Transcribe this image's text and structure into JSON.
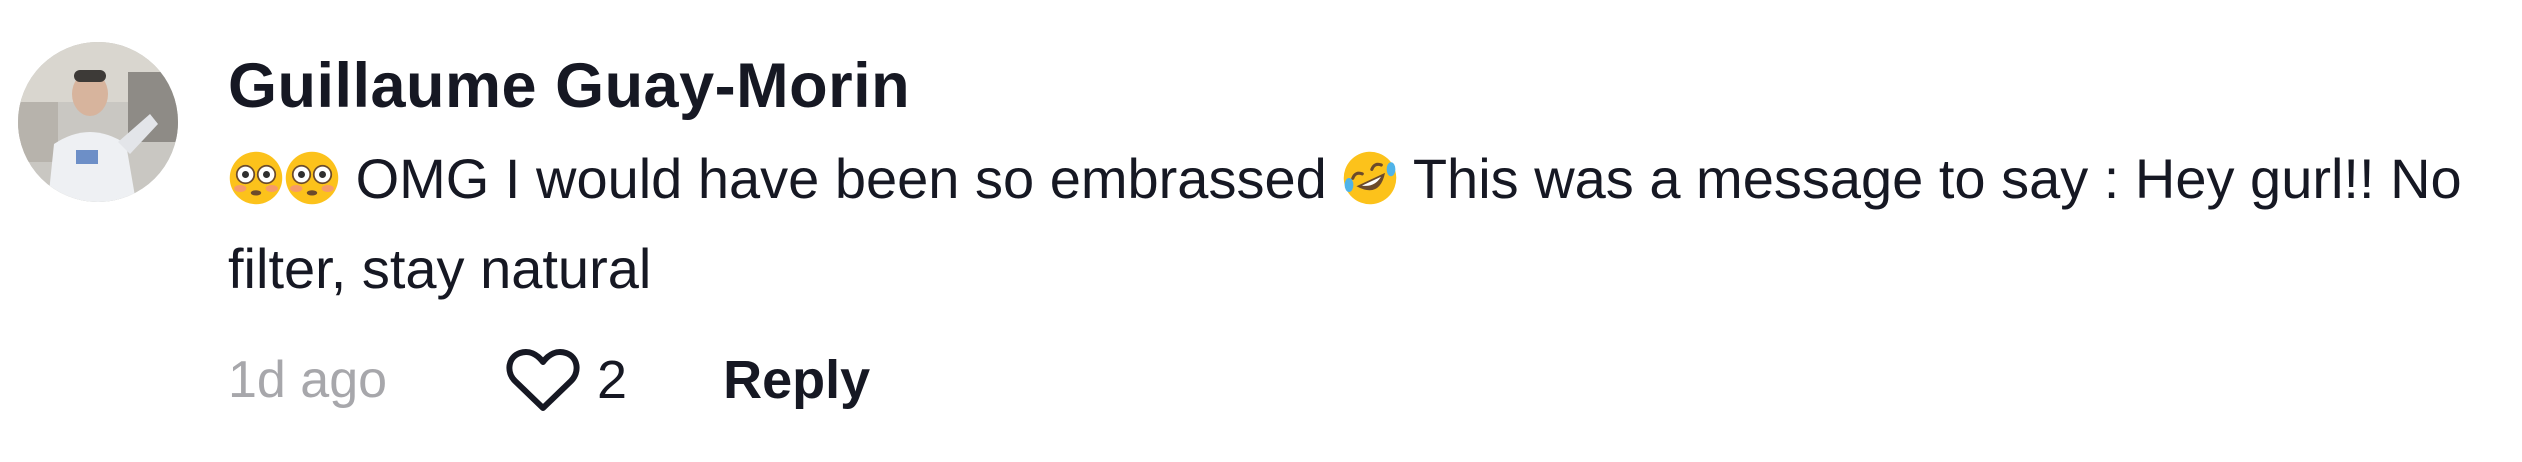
{
  "comment": {
    "username": "Guillaume Guay-Morin",
    "avatar_icon": "user-avatar-photo",
    "text_emoji_lead": [
      "flushed-face-emoji",
      "flushed-face-emoji"
    ],
    "text_part1": "OMG I would have been so embrassed",
    "text_emoji_mid": "rolling-on-floor-laughing-emoji",
    "text_part2": "This was a message to say : Hey gurl!! No filter, stay natural",
    "timestamp": "1d ago",
    "like_icon": "heart-outline-icon",
    "like_count": "2",
    "reply_label": "Reply"
  },
  "colors": {
    "text": "#161823",
    "muted": "#a7a7ab",
    "emoji_yellow": "#fcc21b"
  }
}
